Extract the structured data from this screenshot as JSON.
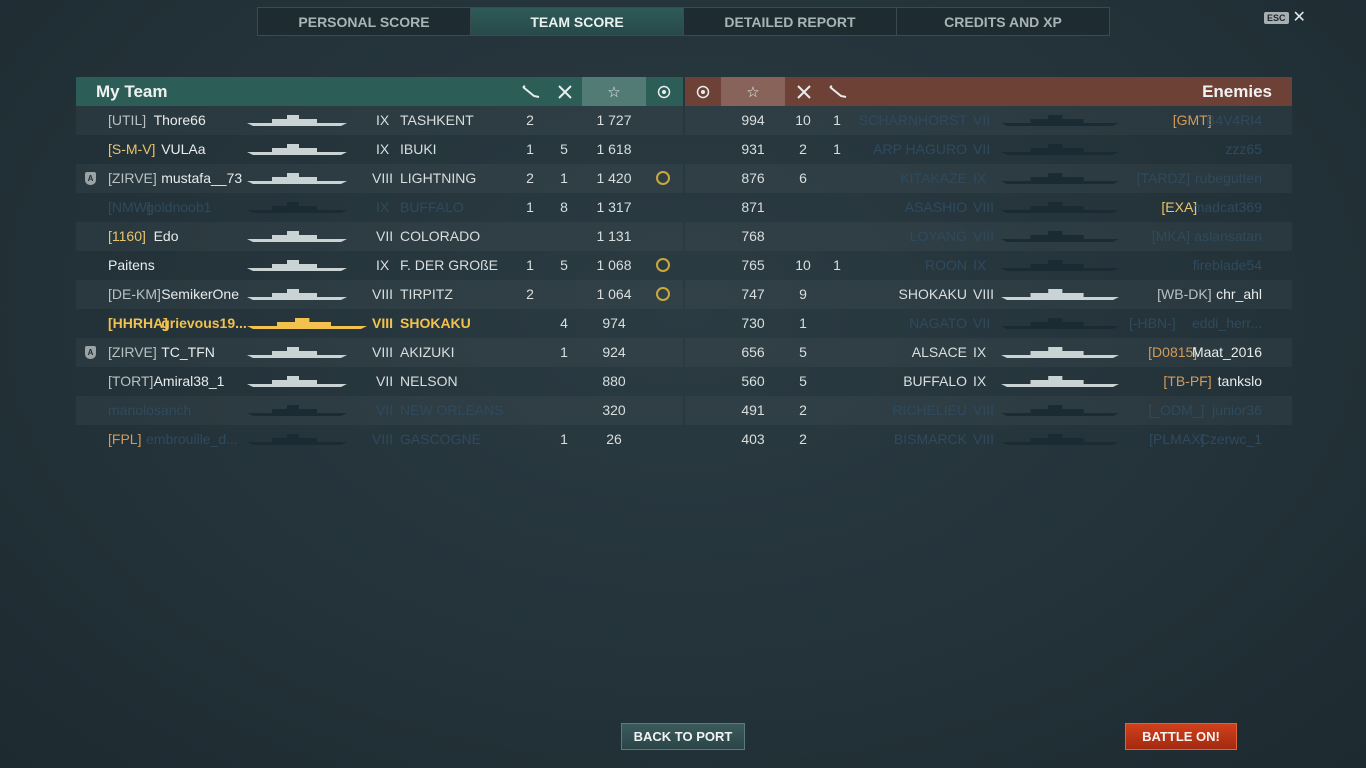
{
  "tabs": [
    {
      "label": "PERSONAL SCORE"
    },
    {
      "label": "TEAM SCORE"
    },
    {
      "label": "DETAILED REPORT"
    },
    {
      "label": "CREDITS AND XP"
    }
  ],
  "esc": {
    "key": "ESC",
    "close": "✕"
  },
  "my_team": {
    "title": "My Team",
    "header_icons": [
      "torpedo-icon",
      "crossed-swords-icon",
      "star-icon",
      "medal-icon"
    ],
    "players": [
      {
        "clan": "[UTIL]",
        "name": "Thore66",
        "tier": "IX",
        "ship": "TASHKENT",
        "c1": "2",
        "c2": "",
        "score": "1 727",
        "medal": false,
        "badge": false,
        "state": "alive",
        "clan_color": ""
      },
      {
        "clan": "[S-M-V]",
        "name": "VULAa",
        "tier": "IX",
        "ship": "IBUKI",
        "c1": "1",
        "c2": "5",
        "score": "1 618",
        "medal": false,
        "badge": false,
        "state": "alive",
        "clan_color": "yellow"
      },
      {
        "clan": "[ZIRVE]",
        "name": "mustafa__73",
        "tier": "VIII",
        "ship": "LIGHTNING",
        "c1": "2",
        "c2": "1",
        "score": "1 420",
        "medal": true,
        "badge": true,
        "state": "alive",
        "clan_color": ""
      },
      {
        "clan": "[NMW]",
        "name": "goldnoob1",
        "tier": "IX",
        "ship": "BUFFALO",
        "c1": "1",
        "c2": "8",
        "score": "1 317",
        "medal": false,
        "badge": false,
        "state": "dead",
        "clan_color": ""
      },
      {
        "clan": "[1160]",
        "name": "Edo",
        "tier": "VII",
        "ship": "COLORADO",
        "c1": "",
        "c2": "",
        "score": "1 131",
        "medal": false,
        "badge": false,
        "state": "alive",
        "clan_color": "yellow"
      },
      {
        "clan": "",
        "name": "Paitens",
        "tier": "IX",
        "ship": "F. DER GROßE",
        "c1": "1",
        "c2": "5",
        "score": "1 068",
        "medal": true,
        "badge": false,
        "state": "alive",
        "clan_color": ""
      },
      {
        "clan": "[DE-KM]",
        "name": "SemikerOne",
        "tier": "VIII",
        "ship": "TIRPITZ",
        "c1": "2",
        "c2": "",
        "score": "1 064",
        "medal": true,
        "badge": false,
        "state": "alive",
        "clan_color": ""
      },
      {
        "clan": "[HHRHA]",
        "name": "grievous19...",
        "tier": "VIII",
        "ship": "SHOKAKU",
        "c1": "",
        "c2": "4",
        "score": "974",
        "medal": false,
        "badge": false,
        "state": "me",
        "clan_color": ""
      },
      {
        "clan": "[ZIRVE]",
        "name": "TC_TFN",
        "tier": "VIII",
        "ship": "AKIZUKI",
        "c1": "",
        "c2": "1",
        "score": "924",
        "medal": false,
        "badge": true,
        "state": "alive",
        "clan_color": ""
      },
      {
        "clan": "[TORT]",
        "name": "Amiral38_1",
        "tier": "VII",
        "ship": "NELSON",
        "c1": "",
        "c2": "",
        "score": "880",
        "medal": false,
        "badge": false,
        "state": "alive",
        "clan_color": ""
      },
      {
        "clan": "",
        "name": "manolosanch",
        "tier": "VII",
        "ship": "NEW ORLEANS",
        "c1": "",
        "c2": "",
        "score": "320",
        "medal": false,
        "badge": false,
        "state": "dead",
        "clan_color": ""
      },
      {
        "clan": "[FPL]",
        "name": "embrouille_d...",
        "tier": "VIII",
        "ship": "GASCOGNE",
        "c1": "",
        "c2": "1",
        "score": "26",
        "medal": false,
        "badge": false,
        "state": "dead",
        "clan_color": "gold"
      }
    ]
  },
  "enemies": {
    "title": "Enemies",
    "header_icons": [
      "medal-icon",
      "star-icon",
      "crossed-swords-icon",
      "torpedo-icon"
    ],
    "players": [
      {
        "score": "994",
        "c2": "10",
        "c1": "1",
        "ship": "SCHARNHORST",
        "tier": "VII",
        "clan": "[GMT]",
        "name": "B4V4RI4",
        "state": "dead",
        "clan_color": "gold"
      },
      {
        "score": "931",
        "c2": "2",
        "c1": "1",
        "ship": "ARP HAGURO",
        "tier": "VII",
        "clan": "",
        "name": "zzz65",
        "state": "dead",
        "clan_color": ""
      },
      {
        "score": "876",
        "c2": "6",
        "c1": "",
        "ship": "KITAKAZE",
        "tier": "IX",
        "clan": "[TARDZ]",
        "name": "rubegutten",
        "state": "dead",
        "clan_color": ""
      },
      {
        "score": "871",
        "c2": "",
        "c1": "",
        "ship": "ASASHIO",
        "tier": "VIII",
        "clan": "[EXA]",
        "name": "madcat369",
        "state": "dead",
        "clan_color": "yellow"
      },
      {
        "score": "768",
        "c2": "",
        "c1": "",
        "ship": "LOYANG",
        "tier": "VIII",
        "clan": "[MKA]",
        "name": "aslansatan",
        "state": "dead",
        "clan_color": ""
      },
      {
        "score": "765",
        "c2": "10",
        "c1": "1",
        "ship": "ROON",
        "tier": "IX",
        "clan": "",
        "name": "fireblade54",
        "state": "dead",
        "clan_color": ""
      },
      {
        "score": "747",
        "c2": "9",
        "c1": "",
        "ship": "SHOKAKU",
        "tier": "VIII",
        "clan": "[WB-DK]",
        "name": "chr_ahl",
        "state": "alive",
        "clan_color": ""
      },
      {
        "score": "730",
        "c2": "1",
        "c1": "",
        "ship": "NAGATO",
        "tier": "VII",
        "clan": "[-HBN-]",
        "name": "eddi_herr...",
        "state": "dead",
        "clan_color": ""
      },
      {
        "score": "656",
        "c2": "5",
        "c1": "",
        "ship": "ALSACE",
        "tier": "IX",
        "clan": "[D0815]",
        "name": "Maat_2016",
        "state": "alive",
        "clan_color": "gold"
      },
      {
        "score": "560",
        "c2": "5",
        "c1": "",
        "ship": "BUFFALO",
        "tier": "IX",
        "clan": "[TB-PF]",
        "name": "tankslo",
        "state": "alive",
        "clan_color": "gold"
      },
      {
        "score": "491",
        "c2": "2",
        "c1": "",
        "ship": "RICHELIEU",
        "tier": "VIII",
        "clan": "[_ODM_]",
        "name": "junior36",
        "state": "dead",
        "clan_color": ""
      },
      {
        "score": "403",
        "c2": "2",
        "c1": "",
        "ship": "BISMARCK",
        "tier": "VIII",
        "clan": "[PLMAX]",
        "name": "Czerwc_1",
        "state": "dead",
        "clan_color": ""
      }
    ]
  },
  "buttons": {
    "back": "BACK TO PORT",
    "battle": "BATTLE ON!"
  },
  "colors": {
    "my_team_header": "#2c5e57",
    "enemy_header": "#6e4136",
    "highlight": "#f2c14e",
    "battle_button": "#c2381a"
  }
}
